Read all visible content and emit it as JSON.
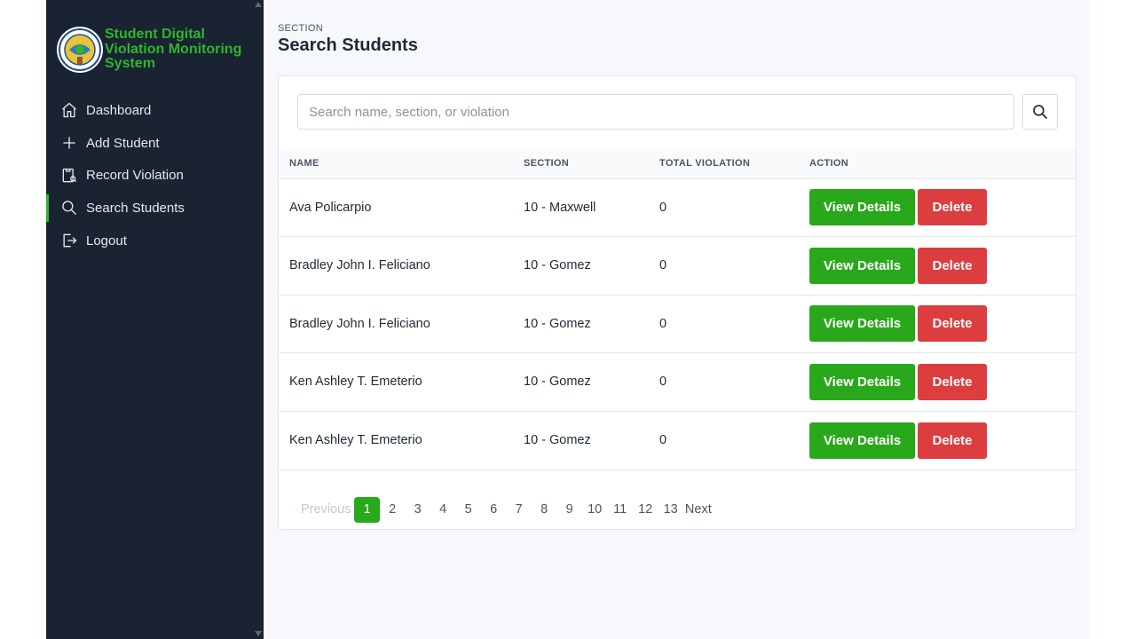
{
  "brand": {
    "title": "Student Digital\nViolation Monitoring\nSystem",
    "color": "#2fb52a"
  },
  "sidebar": {
    "items": [
      {
        "label": "Dashboard",
        "icon": "home-icon"
      },
      {
        "label": "Add Student",
        "icon": "plus-icon"
      },
      {
        "label": "Record Violation",
        "icon": "record-icon"
      },
      {
        "label": "Search Students",
        "icon": "search-icon",
        "active": true
      },
      {
        "label": "Logout",
        "icon": "logout-icon"
      }
    ]
  },
  "header": {
    "section_label": "SECTION",
    "title": "Search Students"
  },
  "search": {
    "placeholder": "Search name, section, or violation",
    "value": ""
  },
  "table": {
    "columns": [
      "NAME",
      "SECTION",
      "TOTAL VIOLATION",
      "ACTION"
    ],
    "rows": [
      {
        "name": "Ava Policarpio",
        "section": "10 - Maxwell",
        "total": "0"
      },
      {
        "name": "Bradley John I. Feliciano",
        "section": "10 - Gomez",
        "total": "0"
      },
      {
        "name": "Bradley John I. Feliciano",
        "section": "10 - Gomez",
        "total": "0"
      },
      {
        "name": "Ken Ashley T. Emeterio",
        "section": "10 - Gomez",
        "total": "0"
      },
      {
        "name": "Ken Ashley T. Emeterio",
        "section": "10 - Gomez",
        "total": "0"
      }
    ],
    "view_label": "View Details",
    "delete_label": "Delete"
  },
  "pagination": {
    "previous": "Previous",
    "pages": [
      "1",
      "2",
      "3",
      "4",
      "5",
      "6",
      "7",
      "8",
      "9",
      "10",
      "11",
      "12",
      "13"
    ],
    "current": "1",
    "next": "Next"
  },
  "colors": {
    "accent_green": "#2aa81b",
    "danger_red": "#dc3d3f",
    "sidebar_bg": "#1a2332"
  }
}
